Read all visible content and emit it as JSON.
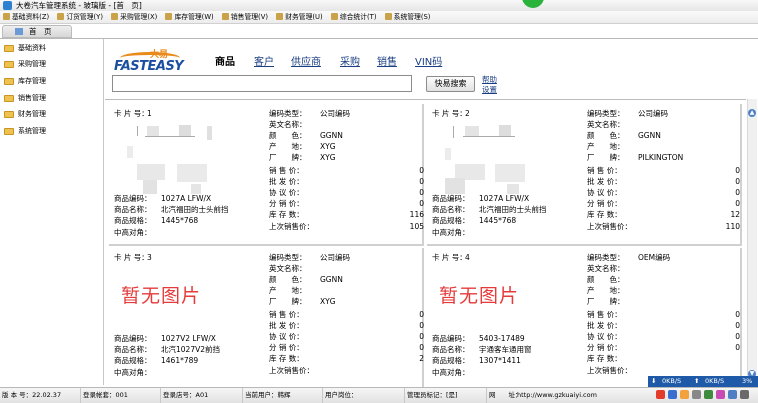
{
  "window": {
    "title": "大卷汽车管理系统 - 玻璃版 - [首　页]"
  },
  "menu": [
    "基础资料(Z)",
    "订货管理(Y)",
    "采购管理(X)",
    "库存管理(W)",
    "销售管理(V)",
    "财务管理(U)",
    "综合统计(T)",
    "系统管理(S)"
  ],
  "home_tab": "首　页",
  "sidebar": {
    "items": [
      "基础资料",
      "采购管理",
      "库存管理",
      "销售管理",
      "财务管理",
      "系统管理"
    ]
  },
  "logo": {
    "top": "大易",
    "bottom": "FASTEASY"
  },
  "nav": {
    "tabs": [
      "商品",
      "客户",
      "供应商",
      "采购",
      "销售",
      "VIN码"
    ]
  },
  "search": {
    "value": "",
    "button": "快易搜索",
    "help": "帮助",
    "settings": "设置"
  },
  "labels": {
    "card_no": "卡 片 号：",
    "code": "商品编码：",
    "name": "商品名称：",
    "spec": "商品规格：",
    "mid": "中高对角：",
    "code_type": "编码类型：",
    "en_name": "英文名称：",
    "color": "颜　　色：",
    "origin": "产　　地：",
    "brand": "厂　　牌：",
    "sale_price": "销 售 价：",
    "wholesale_price": "批 发 价：",
    "agreed_price": "协 议 价：",
    "dist_price": "分 销 价：",
    "stock": "库 存 数：",
    "last_price": "上次销售价："
  },
  "no_image_text": "暂无图片",
  "cards": [
    {
      "no": "1",
      "code": "1027A LFW/X",
      "name": "北汽福田的士头前挡",
      "spec": "1445*768",
      "mid": "",
      "code_type": "公司编码",
      "en_name": "",
      "color": "GGNN",
      "origin": "XYG",
      "brand": "XYG",
      "sale_price": "0",
      "wholesale_price": "0",
      "agreed_price": "0",
      "dist_price": "0",
      "stock": "116",
      "last_price": "105",
      "has_image": true
    },
    {
      "no": "2",
      "code": "1027A LFW/X",
      "name": "北汽福田的士头前挡",
      "spec": "1445*768",
      "mid": "",
      "code_type": "公司编码",
      "en_name": "",
      "color": "GGNN",
      "origin": "",
      "brand": "PILKINGTON",
      "sale_price": "0",
      "wholesale_price": "0",
      "agreed_price": "0",
      "dist_price": "0",
      "stock": "12",
      "last_price": "110",
      "has_image": true
    },
    {
      "no": "3",
      "code": "1027V2 LFW/X",
      "name": "北汽1027V2前挡",
      "spec": "1461*789",
      "mid": "",
      "code_type": "公司编码",
      "en_name": "",
      "color": "GGNN",
      "origin": "",
      "brand": "XYG",
      "sale_price": "0",
      "wholesale_price": "0",
      "agreed_price": "0",
      "dist_price": "0",
      "stock": "2",
      "last_price": "",
      "has_image": false
    },
    {
      "no": "4",
      "code": "5403-17489",
      "name": "宇通客车通用窗",
      "spec": "1307*1411",
      "mid": "",
      "code_type": "OEM编码",
      "en_name": "",
      "color": "",
      "origin": "",
      "brand": "",
      "sale_price": "0",
      "wholesale_price": "0",
      "agreed_price": "0",
      "dist_price": "0",
      "stock": "",
      "last_price": "",
      "has_image": false
    }
  ],
  "netmeter": {
    "down": "0KB/S",
    "up": "0KB/S",
    "pct": "3%"
  },
  "status": {
    "version": "版 本 号：22.02.37",
    "account": "登录帐套：001",
    "store": "登录店号：A01",
    "user": "当前用户：韩辉",
    "post": "用户岗位：",
    "clerk": "管理员标记：[是]",
    "site_label": "网　　址：",
    "site": "http://www.gzkuaiyi.com"
  },
  "colors": {
    "accent": "#1a3f83",
    "noimg": "#e53b3b",
    "logo_orange": "#e98a19",
    "logo_blue": "#1c4fa0",
    "folder": "#efc24f"
  }
}
